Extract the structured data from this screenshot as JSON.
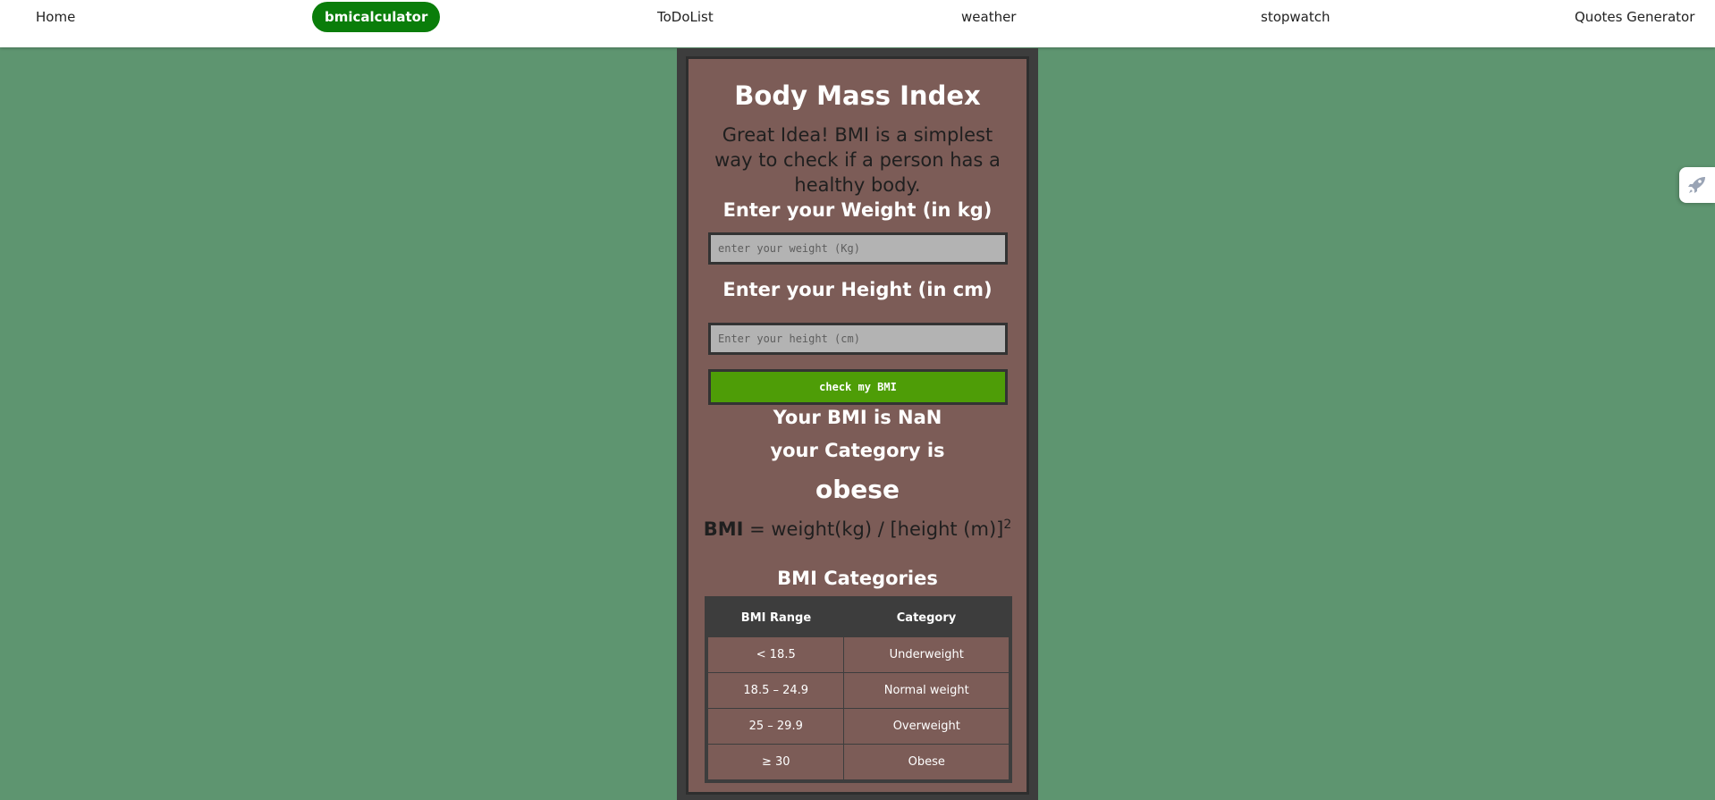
{
  "nav": {
    "home": "Home",
    "bmicalculator": "bmicalculator",
    "todolist": "ToDoList",
    "weather": "weather",
    "stopwatch": "stopwatch",
    "quotes": "Quotes Generator"
  },
  "side_widget": {
    "icon": "rocket-icon"
  },
  "bmi": {
    "title": "Body Mass Index",
    "description": "Great Idea! BMI is a simplest way to check if a person has a healthy body.",
    "weight_label": "Enter your Weight (in kg)",
    "weight_placeholder": "enter your weight (Kg)",
    "weight_value": "",
    "height_label": "Enter your Height (in cm)",
    "height_placeholder": "Enter your height (cm)",
    "height_value": "",
    "button_label": "check my BMI",
    "result_text": "Your BMI is NaN",
    "category_text": "your Category is",
    "category_value": "obese",
    "formula_bmi": "BMI",
    "formula_rest": " = weight(kg) / [height (m)]",
    "formula_exp": "2",
    "categories_heading": "BMI Categories",
    "table": {
      "headers": [
        "BMI Range",
        "Category"
      ],
      "rows": [
        [
          "< 18.5",
          "Underweight"
        ],
        [
          "18.5 – 24.9",
          "Normal weight"
        ],
        [
          "25 – 29.9",
          "Overweight"
        ],
        [
          "≥ 30",
          "Obese"
        ]
      ]
    }
  },
  "colors": {
    "background": "#5e9570",
    "card": "#7c5c57",
    "active_nav": "#0a7d0a",
    "button": "#4e9d07"
  }
}
